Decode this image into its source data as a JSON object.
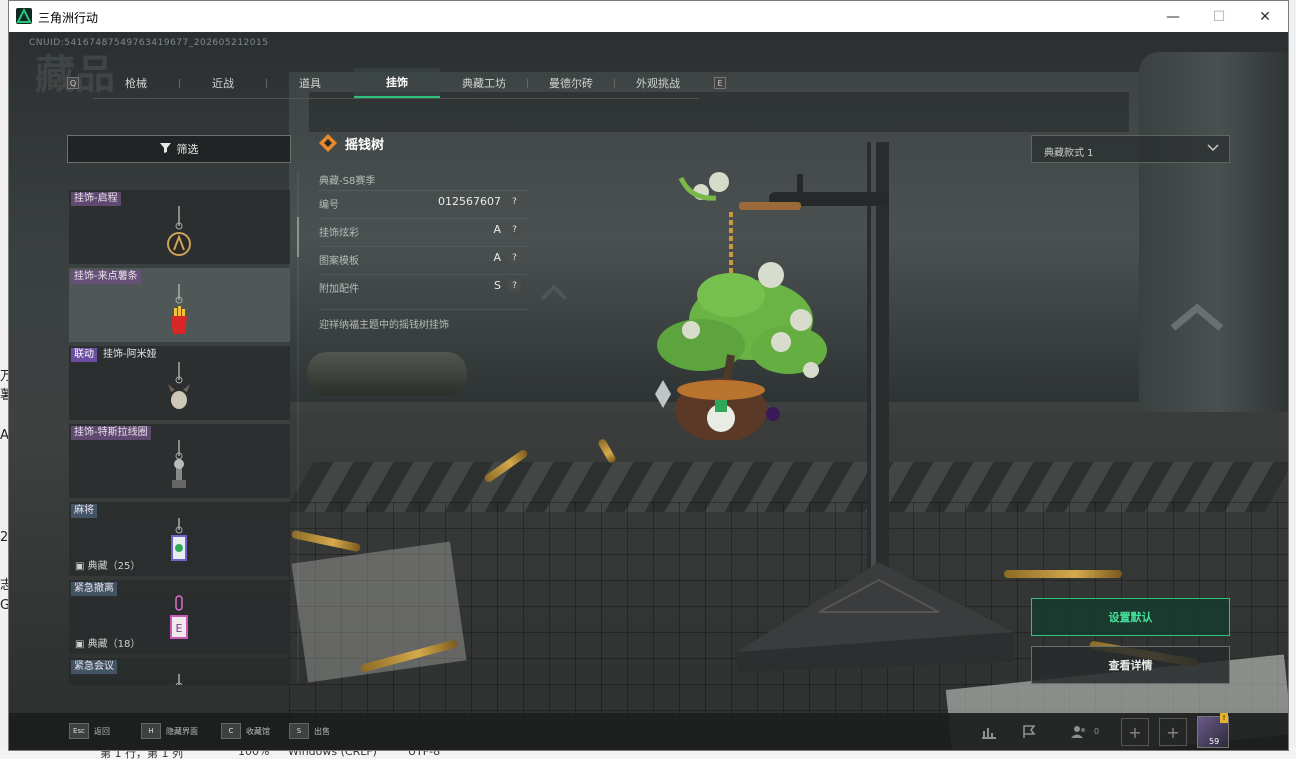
{
  "window": {
    "title": "三角洲行动"
  },
  "game": {
    "uid": "CNUID:54167487549763419677_202605212015",
    "bg_title": "藏品",
    "tab_key_left": "Q",
    "tab_key_right": "E",
    "tabs": [
      {
        "label": "枪械",
        "active": false
      },
      {
        "label": "近战",
        "active": false
      },
      {
        "label": "道具",
        "active": false
      },
      {
        "label": "挂饰",
        "active": true
      },
      {
        "label": "典藏工坊",
        "active": false
      },
      {
        "label": "曼德尔砖",
        "active": false
      },
      {
        "label": "外观挑战",
        "active": false
      }
    ],
    "filter_label": "筛选",
    "list_items": [
      {
        "tag": "挂饰-启程",
        "link": "",
        "count": "",
        "selected": false,
        "tag_style": "purple"
      },
      {
        "tag": "挂饰-来点薯条",
        "link": "",
        "count": "",
        "selected": true,
        "tag_style": "purple"
      },
      {
        "tag": "挂饰-阿米娅",
        "link": "联动",
        "count": "",
        "selected": false,
        "tag_style": "purple"
      },
      {
        "tag": "挂饰-特斯拉线圈",
        "link": "",
        "count": "",
        "selected": false,
        "tag_style": "purple"
      },
      {
        "tag": "麻将",
        "link": "",
        "count": "典藏（25）",
        "selected": false,
        "tag_style": "blue"
      },
      {
        "tag": "紧急撤离",
        "link": "",
        "count": "典藏（18）",
        "selected": false,
        "tag_style": "blue"
      },
      {
        "tag": "紧急会议",
        "link": "",
        "count": "",
        "selected": false,
        "tag_style": "blue"
      }
    ],
    "detail": {
      "title": "摇钱树",
      "season": "典藏-S8赛季",
      "rows": [
        {
          "key": "编号",
          "value": "012567607"
        },
        {
          "key": "挂饰炫彩",
          "value": "A"
        },
        {
          "key": "图案模板",
          "value": "A"
        },
        {
          "key": "附加配件",
          "value": "S"
        }
      ],
      "help_glyph": "?",
      "description": "迎祥纳福主题中的摇钱树挂饰"
    },
    "style_select": {
      "value": "典藏款式 1"
    },
    "buttons": {
      "set_default": "设置默认",
      "view_details": "查看详情"
    },
    "hints": [
      {
        "key": "Esc",
        "label": "返回"
      },
      {
        "key": "H",
        "label": "隐藏界面"
      },
      {
        "key": "C",
        "label": "收藏馆"
      },
      {
        "key": "S",
        "label": "出售"
      }
    ],
    "party_count": "0",
    "player_level": "59",
    "notify_badge": "!",
    "colors": {
      "accent": "#2fc27f",
      "tag_purple": "#6b4ea1"
    }
  },
  "background_app": {
    "status": [
      "第 1 行，第 1 列",
      "100%",
      "Windows (CRLF)",
      "UTF-8"
    ],
    "fragments": [
      "万",
      "薯",
      "A",
      "2",
      "志",
      "G"
    ]
  }
}
